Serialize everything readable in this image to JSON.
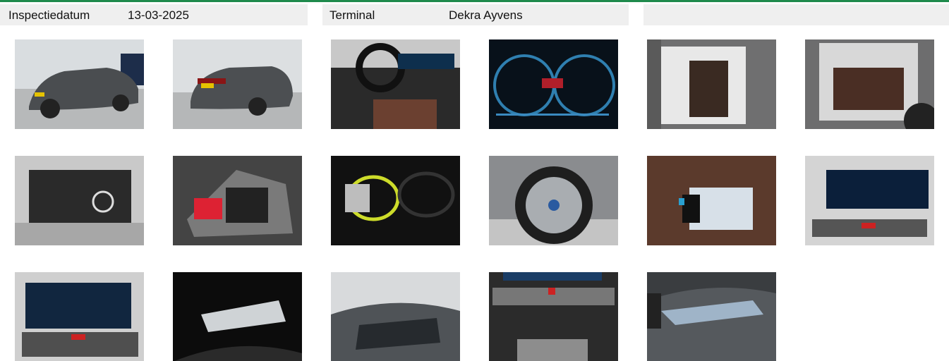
{
  "header": {
    "inspection_label": "Inspectiedatum",
    "inspection_date": "13-03-2025",
    "terminal_label": "Terminal",
    "terminal_value": "Dekra Ayvens"
  },
  "colors": {
    "accent_line": "#1f8a4c",
    "header_bg": "#efefef"
  },
  "photos": [
    {
      "subject": "car-front-left-exterior"
    },
    {
      "subject": "car-rear-left-exterior"
    },
    {
      "subject": "dashboard-interior"
    },
    {
      "subject": "instrument-cluster"
    },
    {
      "subject": "front-seats-open-door"
    },
    {
      "subject": "rear-seats-open-door"
    },
    {
      "subject": "open-trunk"
    },
    {
      "subject": "charging-cable-bag"
    },
    {
      "subject": "charging-cables"
    },
    {
      "subject": "wheel-rim"
    },
    {
      "subject": "manuals-on-seat"
    },
    {
      "subject": "infotainment-screen"
    },
    {
      "subject": "navigation-screen"
    },
    {
      "subject": "panoramic-roof-interior"
    },
    {
      "subject": "panoramic-roof-exterior"
    },
    {
      "subject": "center-console"
    },
    {
      "subject": "headlight"
    }
  ]
}
